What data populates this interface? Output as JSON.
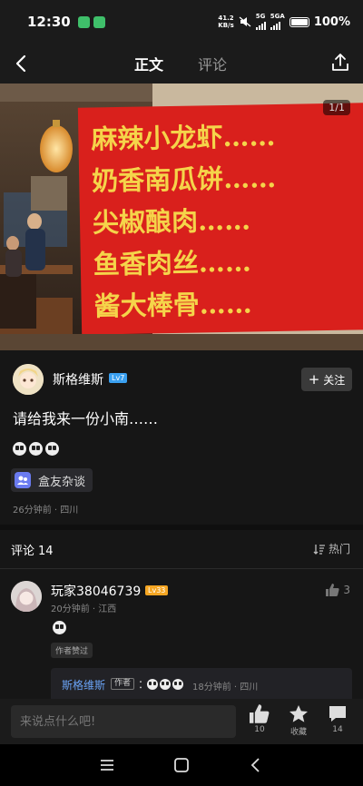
{
  "status_bar": {
    "time": "12:30",
    "net_speed_value": "41.2",
    "net_speed_unit": "KB/s",
    "network_1": "5G",
    "network_2": "5GA",
    "battery": "100%"
  },
  "nav": {
    "tabs": [
      {
        "label": "正文",
        "active": true
      },
      {
        "label": "评论",
        "active": false
      }
    ]
  },
  "hero": {
    "counter": "1/1",
    "menu_lines": [
      "麻辣小龙虾……",
      "奶香南瓜饼……",
      "尖椒酿肉……",
      "鱼香肉丝……",
      "酱大棒骨……"
    ]
  },
  "author": {
    "name": "斯格维斯",
    "level": "Lv7",
    "follow_label": "关注"
  },
  "post": {
    "text": "请给我来一份小南……",
    "tag": "盒友杂谈",
    "meta": "26分钟前 · 四川"
  },
  "comments": {
    "title": "评论",
    "count": "14",
    "sort_label": "热门",
    "items": [
      {
        "name": "玩家38046739",
        "level": "Lv33",
        "meta": "20分钟前 · 江西",
        "likes": "3",
        "badge": "作者赞过",
        "reply": {
          "name": "斯格维斯",
          "author_tag": "作者",
          "colon": "：",
          "meta": "18分钟前 · 四川"
        }
      }
    ]
  },
  "bottom_bar": {
    "input_placeholder": "来说点什么吧!",
    "like_count": "10",
    "favorite_label": "收藏",
    "comment_count": "14"
  },
  "colors": {
    "background": "#161616",
    "sign_red": "#d9201c",
    "sign_text": "#f5d44a",
    "link_blue": "#6aa3f5"
  }
}
